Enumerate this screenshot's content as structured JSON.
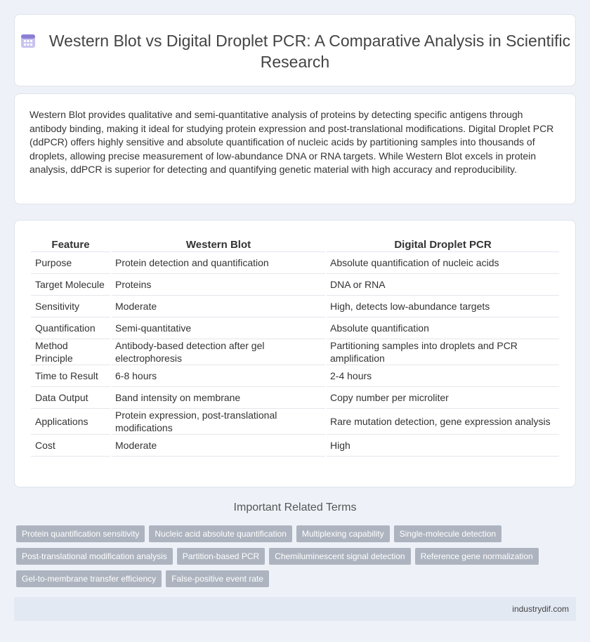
{
  "header": {
    "title": "Western Blot vs Digital Droplet PCR: A Comparative Analysis in Scientific Research",
    "icon": "calendar-grid-icon"
  },
  "summary": "Western Blot provides qualitative and semi-quantitative analysis of proteins by detecting specific antigens through antibody binding, making it ideal for studying protein expression and post-translational modifications. Digital Droplet PCR (ddPCR) offers highly sensitive and absolute quantification of nucleic acids by partitioning samples into thousands of droplets, allowing precise measurement of low-abundance DNA or RNA targets. While Western Blot excels in protein analysis, ddPCR is superior for detecting and quantifying genetic material with high accuracy and reproducibility.",
  "table": {
    "headers": [
      "Feature",
      "Western Blot",
      "Digital Droplet PCR"
    ],
    "rows": [
      [
        "Purpose",
        "Protein detection and quantification",
        "Absolute quantification of nucleic acids"
      ],
      [
        "Target Molecule",
        "Proteins",
        "DNA or RNA"
      ],
      [
        "Sensitivity",
        "Moderate",
        "High, detects low-abundance targets"
      ],
      [
        "Quantification",
        "Semi-quantitative",
        "Absolute quantification"
      ],
      [
        "Method Principle",
        "Antibody-based detection after gel electrophoresis",
        "Partitioning samples into droplets and PCR amplification"
      ],
      [
        "Time to Result",
        "6-8 hours",
        "2-4 hours"
      ],
      [
        "Data Output",
        "Band intensity on membrane",
        "Copy number per microliter"
      ],
      [
        "Applications",
        "Protein expression, post-translational modifications",
        "Rare mutation detection, gene expression analysis"
      ],
      [
        "Cost",
        "Moderate",
        "High"
      ]
    ]
  },
  "related": {
    "title": "Important Related Terms",
    "tags": [
      "Protein quantification sensitivity",
      "Nucleic acid absolute quantification",
      "Multiplexing capability",
      "Single-molecule detection",
      "Post-translational modification analysis",
      "Partition-based PCR",
      "Chemiluminescent signal detection",
      "Reference gene normalization",
      "Gel-to-membrane transfer efficiency",
      "False-positive event rate"
    ]
  },
  "footer": {
    "site": "industrydif.com"
  },
  "colors": {
    "page_bg": "#eef2f8",
    "tag_bg": "#adb4bf",
    "icon_accent": "#8b7fd6"
  }
}
